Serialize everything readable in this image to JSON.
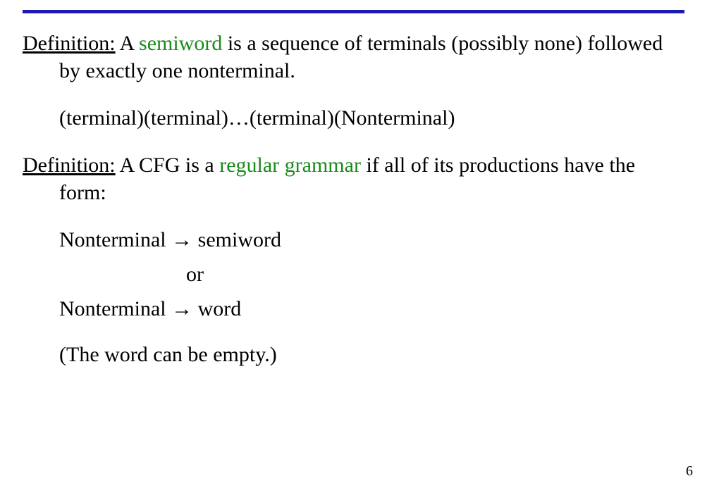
{
  "def1": {
    "label": "Definition:",
    "pre": " A ",
    "term": "semiword",
    "post": " is a sequence of terminals (possibly none) followed by exactly one nonterminal."
  },
  "pattern": "(terminal)(terminal)…(terminal)(Nonterminal)",
  "def2": {
    "label": "Definition:",
    "pre": " A CFG is a ",
    "term": "regular grammar",
    "post": " if all of its productions have the form:"
  },
  "prod": {
    "line1_lhs": "Nonterminal ",
    "arrow": "→",
    "line1_rhs": " semiword",
    "or": "or",
    "line2_lhs": "Nonterminal ",
    "line2_rhs": " word"
  },
  "note": "(The word can be empty.)",
  "page": "6"
}
